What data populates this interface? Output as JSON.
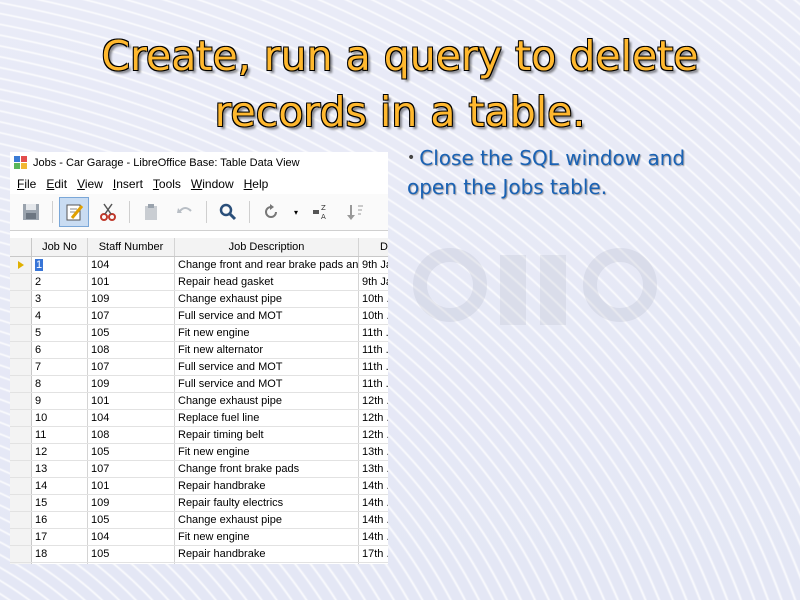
{
  "slide": {
    "title": "Create, run a query to delete records in a table.",
    "bullet": "Close the SQL window and open the Jobs table."
  },
  "window": {
    "title": "Jobs - Car Garage - LibreOffice Base: Table Data View",
    "menu": [
      {
        "mnemonic": "F",
        "rest": "ile"
      },
      {
        "mnemonic": "E",
        "rest": "dit"
      },
      {
        "mnemonic": "V",
        "rest": "iew"
      },
      {
        "mnemonic": "I",
        "rest": "nsert"
      },
      {
        "mnemonic": "T",
        "rest": "ools"
      },
      {
        "mnemonic": "W",
        "rest": "indow"
      },
      {
        "mnemonic": "H",
        "rest": "elp"
      }
    ],
    "toolbar_icons": [
      "save-icon",
      "edit-icon",
      "cut-icon",
      "paste-icon",
      "undo-icon",
      "find-icon",
      "refresh-icon",
      "sort-icon",
      "sort-descending-icon"
    ]
  },
  "table": {
    "columns": [
      "Job No",
      "Staff Number",
      "Job Description",
      "D"
    ],
    "rows": [
      [
        "1",
        "104",
        "Change front and rear brake pads and discs",
        "9th Ja"
      ],
      [
        "2",
        "101",
        "Repair head gasket",
        "9th Ja"
      ],
      [
        "3",
        "109",
        "Change exhaust pipe",
        "10th ."
      ],
      [
        "4",
        "107",
        "Full service and MOT",
        "10th ."
      ],
      [
        "5",
        "105",
        "Fit new engine",
        "11th ."
      ],
      [
        "6",
        "108",
        "Fit new alternator",
        "11th ."
      ],
      [
        "7",
        "107",
        "Full service and MOT",
        "11th ."
      ],
      [
        "8",
        "109",
        "Full service and MOT",
        "11th ."
      ],
      [
        "9",
        "101",
        "Change exhaust pipe",
        "12th ."
      ],
      [
        "10",
        "104",
        "Replace fuel line",
        "12th ."
      ],
      [
        "11",
        "108",
        "Repair timing belt",
        "12th ."
      ],
      [
        "12",
        "105",
        "Fit new engine",
        "13th ."
      ],
      [
        "13",
        "107",
        "Change front brake pads",
        "13th ."
      ],
      [
        "14",
        "101",
        "Repair handbrake",
        "14th ."
      ],
      [
        "15",
        "109",
        "Repair faulty electrics",
        "14th ."
      ],
      [
        "16",
        "105",
        "Change exhaust pipe",
        "14th ."
      ],
      [
        "17",
        "104",
        "Fit new engine",
        "14th ."
      ],
      [
        "18",
        "105",
        "Repair handbrake",
        "17th ."
      ]
    ]
  },
  "colors": {
    "title": "#ffb82e",
    "bullet": "#1a62b4",
    "selection": "#3875d7"
  }
}
